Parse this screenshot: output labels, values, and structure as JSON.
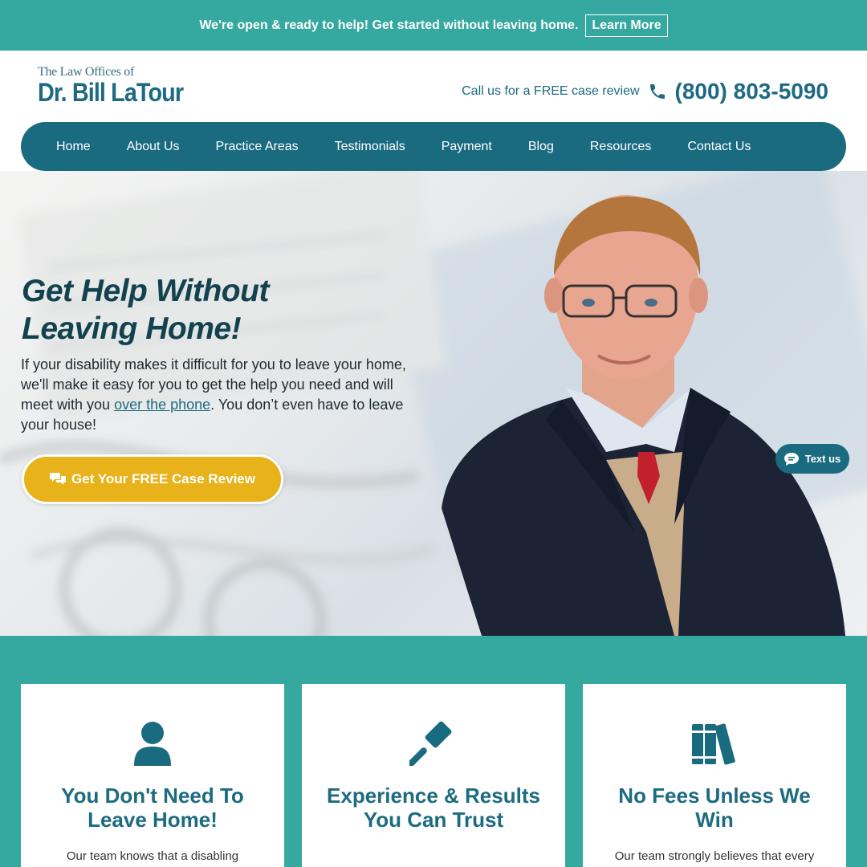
{
  "topbar": {
    "message": "We're open & ready to help! Get started without leaving home.",
    "button": "Learn More"
  },
  "header": {
    "logo_small": "The Law Offices of",
    "logo_big": "Dr. Bill LaTour",
    "call_label": "Call us for a FREE case review",
    "phone": "(800) 803-5090"
  },
  "nav": {
    "items": [
      {
        "label": "Home"
      },
      {
        "label": "About Us"
      },
      {
        "label": "Practice Areas"
      },
      {
        "label": "Testimonials"
      },
      {
        "label": "Payment"
      },
      {
        "label": "Blog"
      },
      {
        "label": "Resources"
      },
      {
        "label": "Contact Us"
      }
    ]
  },
  "hero": {
    "title_line1": "Get Help Without",
    "title_line2": "Leaving Home!",
    "text_before": "If your disability makes it difficult for you to leave your home, we'll make it easy for you to get the help you need and will meet with you ",
    "link": "over the phone",
    "text_after": ". You don’t even have to leave your house!",
    "cta": "Get Your FREE Case Review",
    "text_us": "Text us"
  },
  "features": [
    {
      "icon": "user-icon",
      "title": "You Don't Need To Leave Home!",
      "text": "Our team knows that a disabling"
    },
    {
      "icon": "gavel-icon",
      "title": "Experience & Results You Can Trust",
      "text": ""
    },
    {
      "icon": "books-icon",
      "title": "No Fees Unless We Win",
      "text": "Our team strongly believes that every"
    }
  ],
  "colors": {
    "teal": "#35a8a0",
    "navy_teal": "#1b6b80",
    "gold": "#e8b21b",
    "title_dark": "#13424f"
  }
}
